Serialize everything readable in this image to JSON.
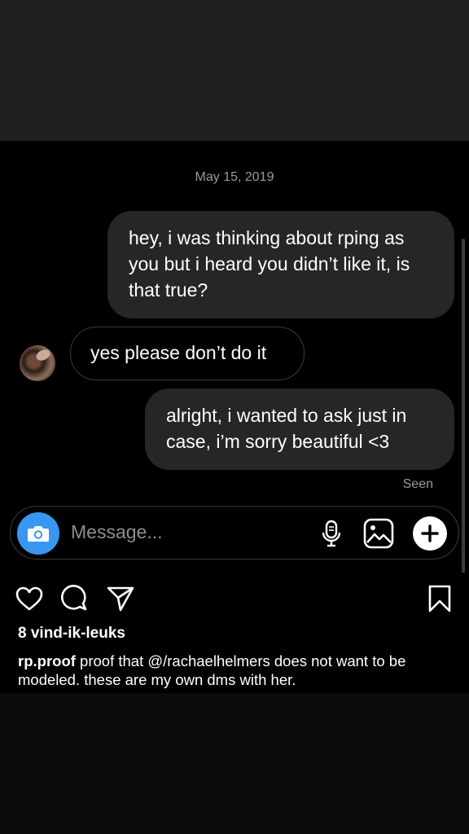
{
  "chat": {
    "date": "May 15, 2019",
    "messages": [
      {
        "direction": "outgoing",
        "text": "hey, i was thinking about rping as you but i heard you didn’t like it, is that true?"
      },
      {
        "direction": "incoming",
        "text": "yes please don’t do it"
      },
      {
        "direction": "outgoing",
        "text": "alright, i wanted to ask just in case, i’m sorry beautiful <3"
      }
    ],
    "seen": "Seen"
  },
  "composer": {
    "placeholder": "Message...",
    "icons": [
      "camera-icon",
      "microphone-icon",
      "gallery-icon",
      "plus-icon"
    ]
  },
  "post": {
    "likes": "8 vind-ik-leuks",
    "username": "rp.proof",
    "caption": "proof that @/rachaelhelmers does not want to be modeled. these are my own dms with her.",
    "icons": [
      "heart-icon",
      "comment-icon",
      "share-icon",
      "bookmark-icon"
    ]
  },
  "colors": {
    "accent": "#3897f0",
    "outgoing_bubble": "#262626",
    "background": "#000000"
  }
}
